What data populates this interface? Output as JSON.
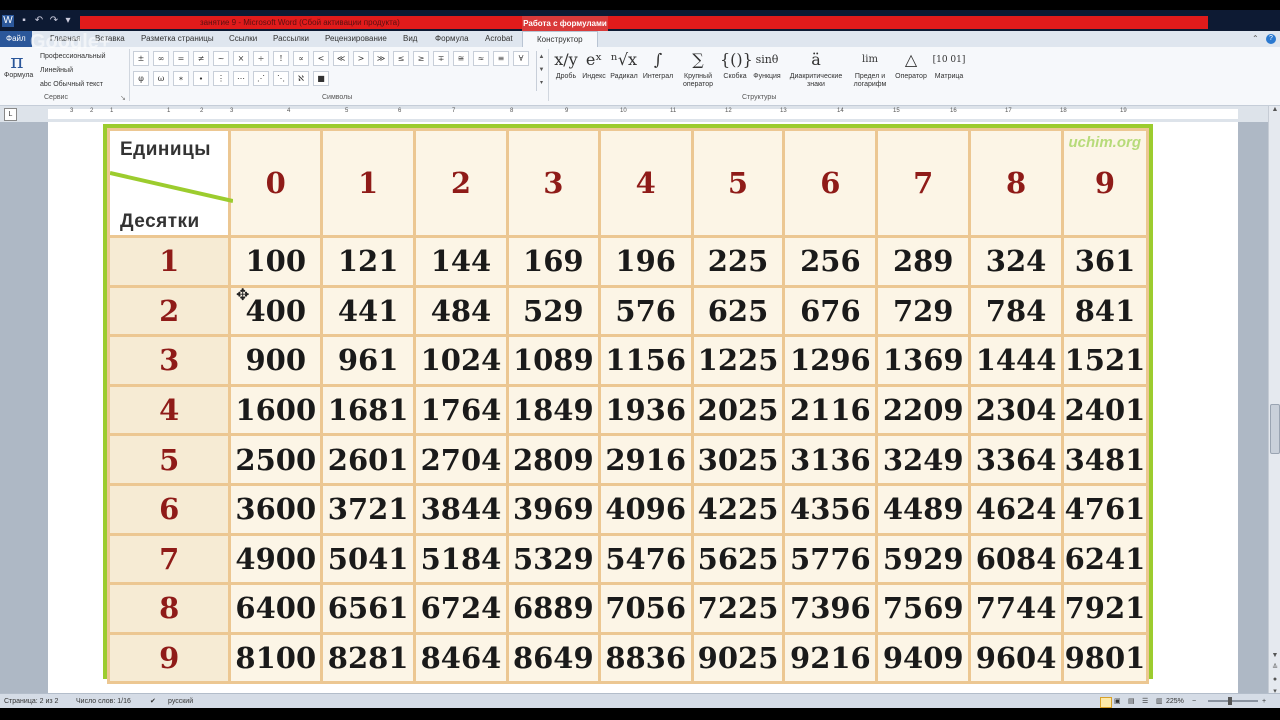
{
  "window": {
    "title": "занятие 9 - Microsoft Word (Сбой активации продукта)",
    "context_tab_header": "Работа с формулами",
    "watermark_overlay": "Google+"
  },
  "tabs": [
    "Файл",
    "Главная",
    "Вставка",
    "Разметка страницы",
    "Ссылки",
    "Рассылки",
    "Рецензирование",
    "Вид",
    "Формула",
    "Acrobat",
    "Конструктор"
  ],
  "ribbon": {
    "service": {
      "formula_label": "Формула",
      "professional_label": "Профессиональный",
      "linear_label": "Линейный",
      "plain_text_label": "abc Обычный текст",
      "group_label": "Сервис"
    },
    "symbols": {
      "group_label": "Символы",
      "row1": [
        "±",
        "∞",
        "=",
        "≠",
        "~",
        "×",
        "÷",
        "!",
        "∝",
        "<",
        "≪",
        ">",
        "≫",
        "≤",
        "≥",
        "∓",
        "≅",
        "≈",
        "≡",
        "∀",
        "∁",
        "∂",
        "√",
        "∛",
        "∜",
        "∪",
        "∩",
        "∅",
        "%",
        "°",
        "℉",
        "℃",
        "∆",
        "∇",
        "∃",
        "∄",
        "∈",
        "∋",
        "←",
        "↑",
        "→",
        "↓",
        "↔",
        "∴",
        "+",
        "−",
        "¬",
        "α",
        "β",
        "γ",
        "δ",
        "ε",
        "ϵ",
        "θ",
        "ϑ",
        "μ",
        "π",
        "ρ",
        "σ",
        "τ"
      ],
      "row2": [
        "φ",
        "ω",
        "∗",
        "∙",
        "⋮",
        "⋯",
        "⋰",
        "⋱",
        "ℵ",
        "■"
      ]
    },
    "structures": {
      "group_label": "Структуры",
      "tools": [
        {
          "glyph": "x/y",
          "label": "Дробь"
        },
        {
          "glyph": "eˣ",
          "label": "Индекс"
        },
        {
          "glyph": "ⁿ√x",
          "label": "Радикал"
        },
        {
          "glyph": "∫",
          "label": "Интеграл"
        },
        {
          "glyph": "∑",
          "label": "Крупный оператор"
        },
        {
          "glyph": "{()}",
          "label": "Скобка"
        },
        {
          "glyph": "sinθ",
          "label": "Функция"
        },
        {
          "glyph": "ä",
          "label": "Диакритические знаки"
        },
        {
          "glyph": "lim",
          "label": "Предел и логарифм"
        },
        {
          "glyph": "△",
          "label": "Оператор"
        },
        {
          "glyph": "[10 01]",
          "label": "Матрица"
        }
      ]
    }
  },
  "ruler": {
    "numbers": [
      "3",
      "2",
      "1",
      "1",
      "2",
      "3",
      "4",
      "5",
      "6",
      "7",
      "8",
      "9",
      "10",
      "11",
      "12",
      "13",
      "14",
      "15",
      "16",
      "17",
      "18",
      "19"
    ]
  },
  "table": {
    "units_label": "Единицы",
    "tens_label": "Десятки",
    "watermark": "uchim.org",
    "col_headers": [
      "0",
      "1",
      "2",
      "3",
      "4",
      "5",
      "6",
      "7",
      "8",
      "9"
    ],
    "rows": [
      {
        "tens": "1",
        "values": [
          "100",
          "121",
          "144",
          "169",
          "196",
          "225",
          "256",
          "289",
          "324",
          "361"
        ]
      },
      {
        "tens": "2",
        "values": [
          "400",
          "441",
          "484",
          "529",
          "576",
          "625",
          "676",
          "729",
          "784",
          "841"
        ]
      },
      {
        "tens": "3",
        "values": [
          "900",
          "961",
          "1024",
          "1089",
          "1156",
          "1225",
          "1296",
          "1369",
          "1444",
          "1521"
        ]
      },
      {
        "tens": "4",
        "values": [
          "1600",
          "1681",
          "1764",
          "1849",
          "1936",
          "2025",
          "2116",
          "2209",
          "2304",
          "2401"
        ]
      },
      {
        "tens": "5",
        "values": [
          "2500",
          "2601",
          "2704",
          "2809",
          "2916",
          "3025",
          "3136",
          "3249",
          "3364",
          "3481"
        ]
      },
      {
        "tens": "6",
        "values": [
          "3600",
          "3721",
          "3844",
          "3969",
          "4096",
          "4225",
          "4356",
          "4489",
          "4624",
          "4761"
        ]
      },
      {
        "tens": "7",
        "values": [
          "4900",
          "5041",
          "5184",
          "5329",
          "5476",
          "5625",
          "5776",
          "5929",
          "6084",
          "6241"
        ]
      },
      {
        "tens": "8",
        "values": [
          "6400",
          "6561",
          "6724",
          "6889",
          "7056",
          "7225",
          "7396",
          "7569",
          "7744",
          "7921"
        ]
      },
      {
        "tens": "9",
        "values": [
          "8100",
          "8281",
          "8464",
          "8649",
          "8836",
          "9025",
          "9216",
          "9409",
          "9604",
          "9801"
        ]
      }
    ]
  },
  "status": {
    "page": "Страница: 2 из 2",
    "words": "Число слов: 1/16",
    "language": "русский",
    "zoom": "225%"
  }
}
